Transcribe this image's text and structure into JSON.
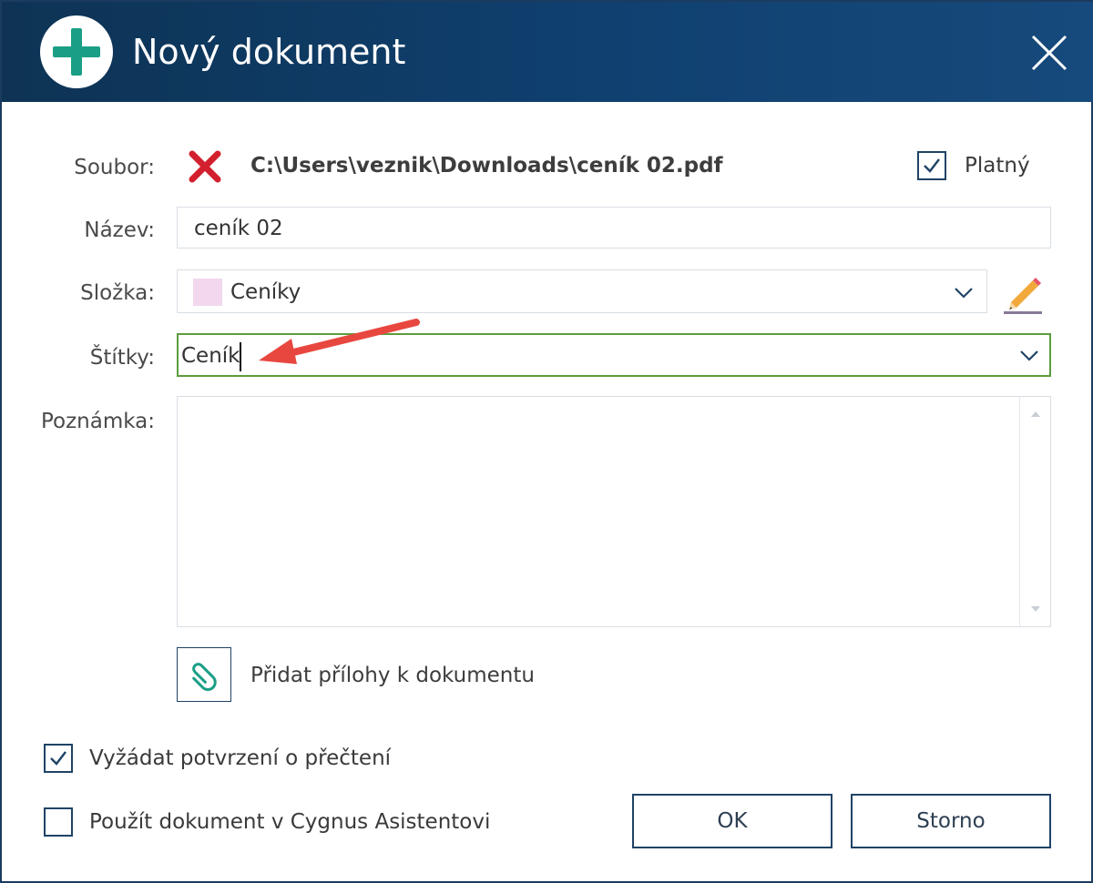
{
  "window": {
    "title": "Nový dokument",
    "title_icon": "plus-circle-icon",
    "close_icon": "close-icon"
  },
  "file": {
    "label": "Soubor:",
    "remove_icon": "remove-x-icon",
    "path": "C:\\Users\\veznik\\Downloads\\ceník 02.pdf",
    "valid_label": "Platný",
    "valid_checked": true
  },
  "name": {
    "label": "Název:",
    "value": "ceník 02"
  },
  "folder": {
    "label": "Složka:",
    "value": "Ceníky",
    "swatch_color": "#f2d7ee",
    "edit_icon": "pencil-icon"
  },
  "tags": {
    "label": "Štítky:",
    "value": "Ceník"
  },
  "note": {
    "label": "Poznámka:",
    "value": ""
  },
  "attachments": {
    "icon": "paperclip-icon",
    "label": "Přidat přílohy k dokumentu"
  },
  "options": {
    "read_receipt_label": "Vyžádat potvrzení o přečtení",
    "read_receipt_checked": true,
    "assistant_label": "Použít dokument v Cygnus Asistentovi",
    "assistant_checked": false
  },
  "buttons": {
    "ok": "OK",
    "cancel": "Storno"
  },
  "colors": {
    "titlebar": "#0f4070",
    "accent_green": "#1a9f86",
    "focus_border": "#5d9c3d",
    "annotation_arrow": "#e8473f",
    "remove_red": "#d3202e"
  }
}
